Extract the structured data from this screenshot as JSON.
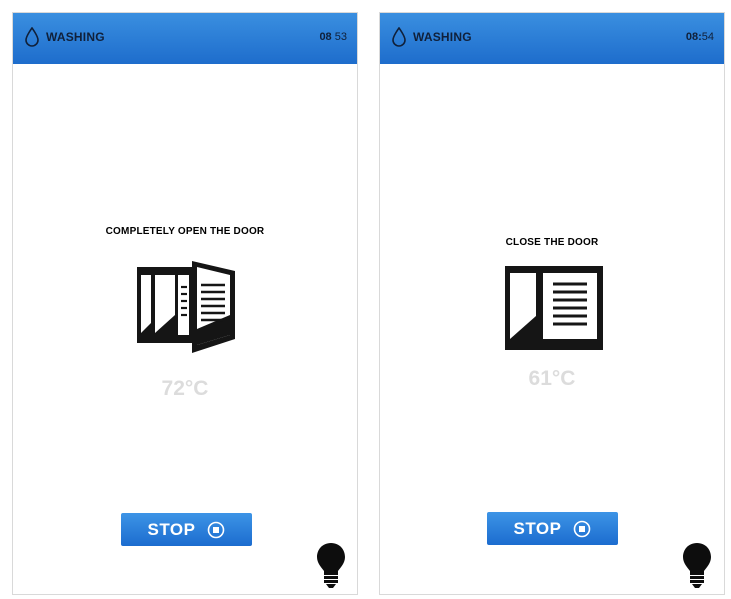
{
  "colors": {
    "header_blue": "#2a7fd8",
    "stop_button_blue": "#2277d6",
    "temperature_gray": "#dcdcdc",
    "text_black": "#000000"
  },
  "screens": [
    {
      "header": {
        "title": "WASHING",
        "icon": "water-drop-icon",
        "time_hours": "08",
        "time_sep": " ",
        "time_minutes": "53"
      },
      "instruction": "COMPLETELY OPEN THE DOOR",
      "illustration": "door-open-icon",
      "temperature": "72°C",
      "stop_button": {
        "label": "STOP",
        "icon": "stop-circle-icon"
      },
      "help_icon": "lightbulb-icon"
    },
    {
      "header": {
        "title": "WASHING",
        "icon": "water-drop-icon",
        "time_hours": "08",
        "time_sep": ":",
        "time_minutes": "54"
      },
      "instruction": "CLOSE THE DOOR",
      "illustration": "door-closed-icon",
      "temperature": "61°C",
      "stop_button": {
        "label": "STOP",
        "icon": "stop-circle-icon"
      },
      "help_icon": "lightbulb-icon"
    }
  ]
}
